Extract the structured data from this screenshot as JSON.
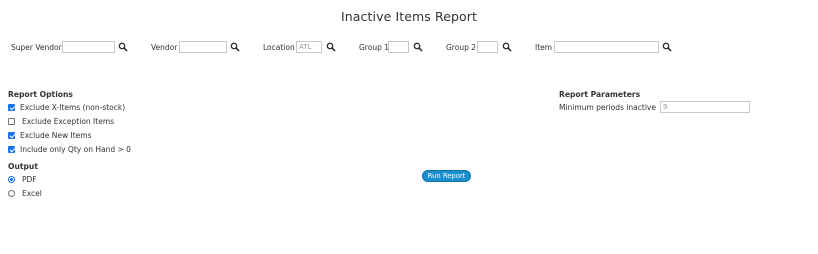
{
  "report": {
    "title": "Inactive Items Report"
  },
  "filters": {
    "super_vendor": {
      "label": "Super Vendor",
      "value": ""
    },
    "vendor": {
      "label": "Vendor",
      "value": ""
    },
    "location": {
      "label": "Location",
      "value": "ATL"
    },
    "group1": {
      "label": "Group 1",
      "value": ""
    },
    "group2": {
      "label": "Group 2",
      "value": ""
    },
    "item": {
      "label": "Item",
      "value": ""
    },
    "search_icon": "search-icon"
  },
  "report_options": {
    "heading": "Report Options",
    "items": [
      {
        "label": "Exclude X-Items (non-stock)",
        "checked": true
      },
      {
        "label": "Exclude Exception Items",
        "checked": false
      },
      {
        "label": "Exclude New Items",
        "checked": true
      },
      {
        "label": "Include only Qty on Hand > 0",
        "checked": true
      }
    ]
  },
  "output": {
    "heading": "Output",
    "options": [
      {
        "label": "PDF",
        "selected": true
      },
      {
        "label": "Excel",
        "selected": false
      }
    ]
  },
  "run_button": {
    "label": "Run Report"
  },
  "report_parameters": {
    "heading": "Report Parameters",
    "min_periods_label": "Minimum periods inactive",
    "min_periods_value": "9"
  },
  "colors": {
    "accent": "#1a73e8",
    "button": "#1a8fd0"
  }
}
